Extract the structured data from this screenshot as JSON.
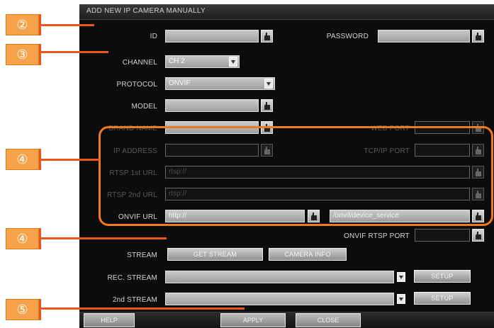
{
  "dialog": {
    "title": "ADD NEW IP CAMERA MANUALLY"
  },
  "fields": {
    "id_label": "ID",
    "password_label": "PASSWORD",
    "channel_label": "CHANNEL",
    "channel_value": "CH 2",
    "protocol_label": "PROTOCOL",
    "protocol_value": "ONVIF",
    "model_label": "MODEL",
    "brand_label": "BRAND NAME",
    "web_port_label": "WEB PORT",
    "ip_address_label": "IP ADDRESS",
    "tcpip_port_label": "TCP/IP PORT",
    "rtsp1_label": "RTSP 1st URL",
    "rtsp1_value": "rtsp://",
    "rtsp2_label": "RTSP 2nd URL",
    "rtsp2_value": "rtsp://",
    "onvif_url_label": "ONVIF URL",
    "onvif_url_value": "http://",
    "onvif_path_value": "/onvif/device_service",
    "onvif_rtsp_port_label": "ONVIF RTSP PORT",
    "stream_label": "STREAM",
    "rec_stream_label": "REC. STREAM",
    "second_stream_label": "2nd STREAM"
  },
  "buttons": {
    "get_stream": "GET STREAM",
    "camera_info": "CAMERA INFO",
    "setup": "SETUP",
    "help": "HELP",
    "apply": "APPLY",
    "close": "CLOSE"
  },
  "callouts": [
    "②",
    "③",
    "④",
    "④",
    "⑤"
  ],
  "colors": {
    "callout_fill": "#f5a24a",
    "callout_line": "#e8571c",
    "highlight": "#f07a1e",
    "dialog_bg": "#0c0c0c"
  }
}
